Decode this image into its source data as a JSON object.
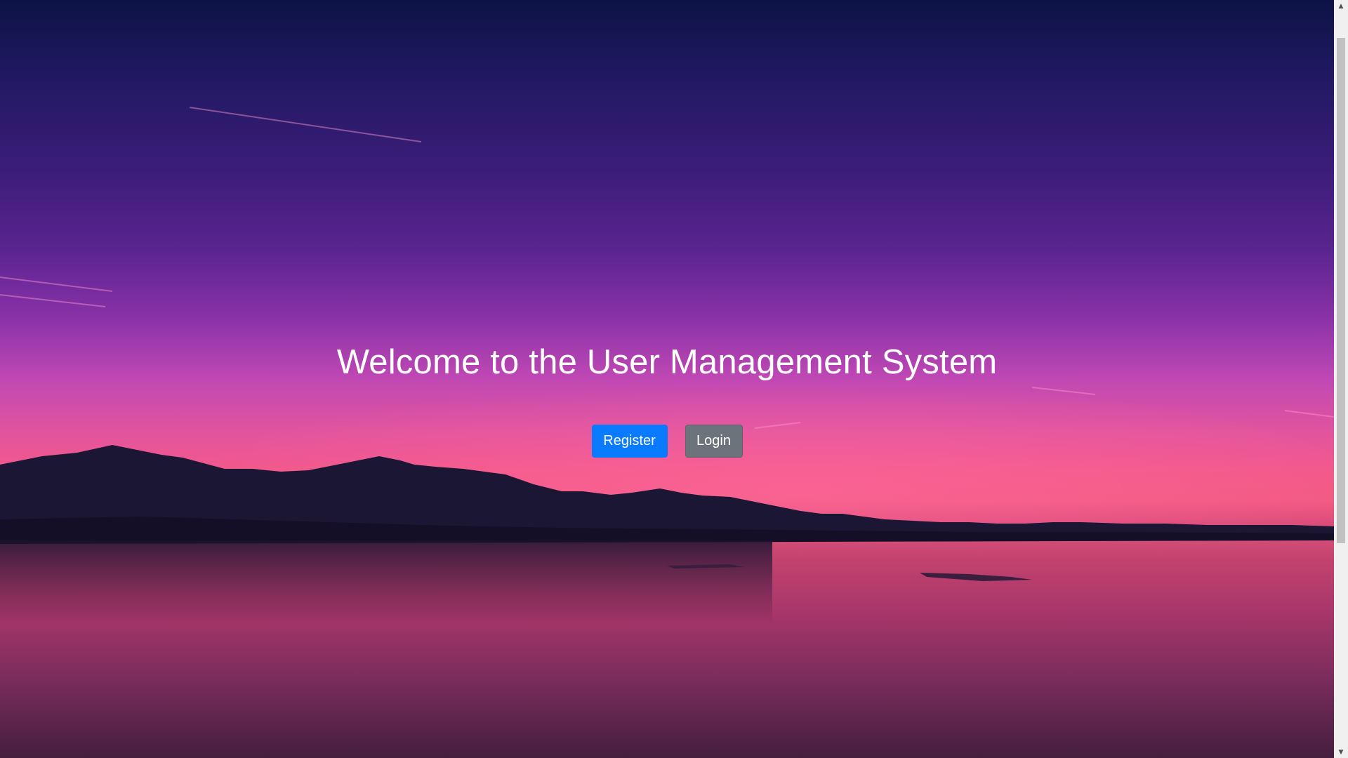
{
  "hero": {
    "title": "Welcome to the User Management System"
  },
  "buttons": {
    "register_label": "Register",
    "login_label": "Login"
  },
  "colors": {
    "primary_button": "#0a7bff",
    "secondary_button": "#6c737b",
    "title_text": "#ffffff"
  },
  "scrollbar": {
    "up_icon": "triangle-up",
    "down_icon": "triangle-down"
  }
}
